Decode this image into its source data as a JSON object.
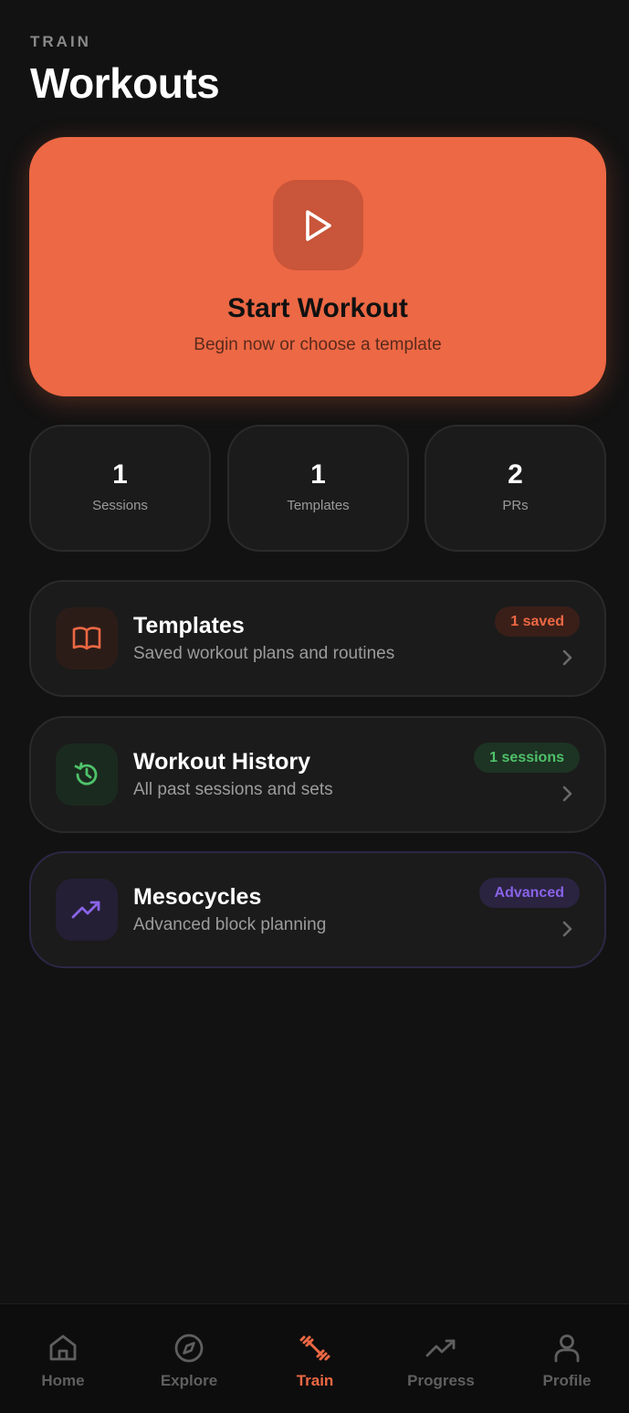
{
  "header": {
    "eyebrow": "TRAIN",
    "title": "Workouts"
  },
  "hero": {
    "title": "Start Workout",
    "subtitle": "Begin now or choose a template",
    "icon": "play-icon",
    "color": "#ed6844"
  },
  "stats": [
    {
      "value": "1",
      "label": "Sessions"
    },
    {
      "value": "1",
      "label": "Templates"
    },
    {
      "value": "2",
      "label": "PRs"
    }
  ],
  "cards": [
    {
      "title": "Templates",
      "subtitle": "Saved workout plans and routines",
      "badge": "1 saved",
      "icon": "book-open-icon",
      "accent": "#ed6844"
    },
    {
      "title": "Workout History",
      "subtitle": "All past sessions and sets",
      "badge": "1 sessions",
      "icon": "history-icon",
      "accent": "#4fc26a"
    },
    {
      "title": "Mesocycles",
      "subtitle": "Advanced block planning",
      "badge": "Advanced",
      "icon": "trending-up-icon",
      "accent": "#8a63e8"
    }
  ],
  "tabs": [
    {
      "label": "Home",
      "icon": "home-icon",
      "active": false
    },
    {
      "label": "Explore",
      "icon": "compass-icon",
      "active": false
    },
    {
      "label": "Train",
      "icon": "dumbbell-icon",
      "active": true
    },
    {
      "label": "Progress",
      "icon": "trending-up-icon",
      "active": false
    },
    {
      "label": "Profile",
      "icon": "user-icon",
      "active": false
    }
  ]
}
